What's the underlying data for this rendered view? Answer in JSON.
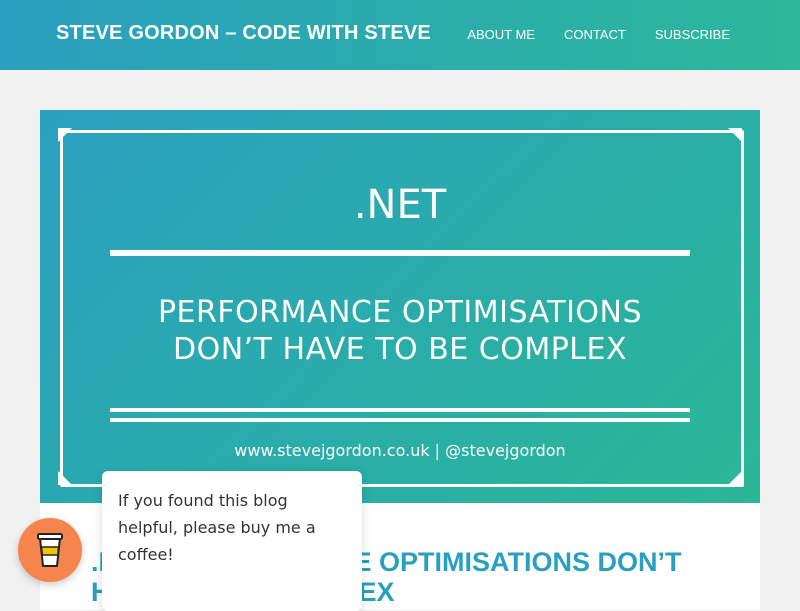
{
  "header": {
    "site_title": "STEVE GORDON – CODE WITH STEVE",
    "nav": [
      "ABOUT ME",
      "CONTACT",
      "SUBSCRIBE"
    ],
    "gradient_colors": [
      "#2a9fbf",
      "#2cb89a"
    ]
  },
  "hero": {
    "tag": ".NET",
    "line1": "PERFORMANCE OPTIMISATIONS",
    "line2": "DON’T HAVE TO BE COMPLEX",
    "footer": "www.stevejgordon.co.uk | @stevejgordon"
  },
  "post": {
    "title": ".NET PERFORMANCE OPTIMISATIONS DON’T HAVE TO BE COMPLEX",
    "title_color": "#2aa0c0"
  },
  "bmc": {
    "popup_text": "If you found this blog helpful, please buy me a coffee!",
    "button_icon": "coffee-cup-icon",
    "button_color": "#f5844d"
  }
}
